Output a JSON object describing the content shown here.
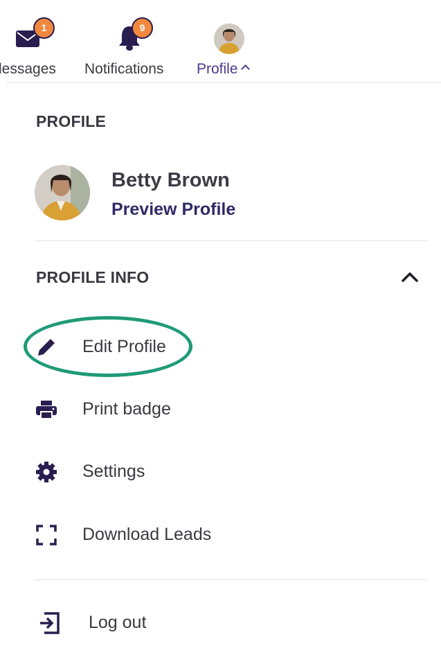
{
  "nav": {
    "messages": {
      "label": "lessages",
      "badge": "1"
    },
    "notifications": {
      "label": "Notifications",
      "badge": "9"
    },
    "profile": {
      "label": "Profile"
    }
  },
  "dropdown": {
    "profile_heading": "PROFILE",
    "user": {
      "name": "Betty Brown",
      "preview_label": "Preview Profile"
    },
    "profile_info_heading": "PROFILE INFO",
    "items": [
      {
        "label": "Edit Profile",
        "icon": "pencil-icon"
      },
      {
        "label": "Print badge",
        "icon": "printer-icon"
      },
      {
        "label": "Settings",
        "icon": "gear-icon"
      },
      {
        "label": "Download Leads",
        "icon": "scan-frame-icon"
      }
    ],
    "logout_label": "Log out"
  },
  "colors": {
    "accent": "#2e2a66",
    "badge": "#f0883e",
    "highlight": "#1f9a76",
    "icon": "#2a1d4f"
  }
}
